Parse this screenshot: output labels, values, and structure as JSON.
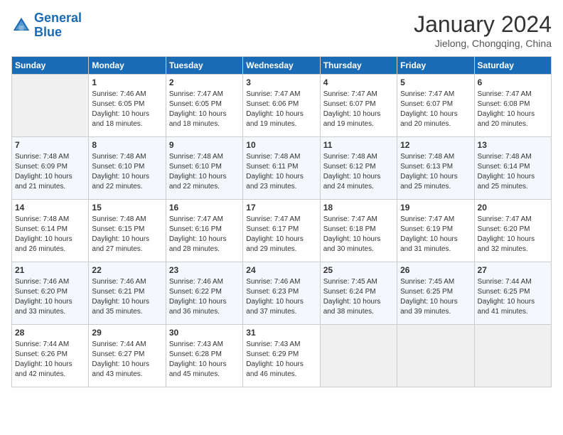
{
  "header": {
    "logo_line1": "General",
    "logo_line2": "Blue",
    "title": "January 2024",
    "location": "Jielong, Chongqing, China"
  },
  "days_of_week": [
    "Sunday",
    "Monday",
    "Tuesday",
    "Wednesday",
    "Thursday",
    "Friday",
    "Saturday"
  ],
  "weeks": [
    [
      {
        "day": "",
        "sunrise": "",
        "sunset": "",
        "daylight": ""
      },
      {
        "day": "1",
        "sunrise": "Sunrise: 7:46 AM",
        "sunset": "Sunset: 6:05 PM",
        "daylight": "Daylight: 10 hours and 18 minutes."
      },
      {
        "day": "2",
        "sunrise": "Sunrise: 7:47 AM",
        "sunset": "Sunset: 6:05 PM",
        "daylight": "Daylight: 10 hours and 18 minutes."
      },
      {
        "day": "3",
        "sunrise": "Sunrise: 7:47 AM",
        "sunset": "Sunset: 6:06 PM",
        "daylight": "Daylight: 10 hours and 19 minutes."
      },
      {
        "day": "4",
        "sunrise": "Sunrise: 7:47 AM",
        "sunset": "Sunset: 6:07 PM",
        "daylight": "Daylight: 10 hours and 19 minutes."
      },
      {
        "day": "5",
        "sunrise": "Sunrise: 7:47 AM",
        "sunset": "Sunset: 6:07 PM",
        "daylight": "Daylight: 10 hours and 20 minutes."
      },
      {
        "day": "6",
        "sunrise": "Sunrise: 7:47 AM",
        "sunset": "Sunset: 6:08 PM",
        "daylight": "Daylight: 10 hours and 20 minutes."
      }
    ],
    [
      {
        "day": "7",
        "sunrise": "Sunrise: 7:48 AM",
        "sunset": "Sunset: 6:09 PM",
        "daylight": "Daylight: 10 hours and 21 minutes."
      },
      {
        "day": "8",
        "sunrise": "Sunrise: 7:48 AM",
        "sunset": "Sunset: 6:10 PM",
        "daylight": "Daylight: 10 hours and 22 minutes."
      },
      {
        "day": "9",
        "sunrise": "Sunrise: 7:48 AM",
        "sunset": "Sunset: 6:10 PM",
        "daylight": "Daylight: 10 hours and 22 minutes."
      },
      {
        "day": "10",
        "sunrise": "Sunrise: 7:48 AM",
        "sunset": "Sunset: 6:11 PM",
        "daylight": "Daylight: 10 hours and 23 minutes."
      },
      {
        "day": "11",
        "sunrise": "Sunrise: 7:48 AM",
        "sunset": "Sunset: 6:12 PM",
        "daylight": "Daylight: 10 hours and 24 minutes."
      },
      {
        "day": "12",
        "sunrise": "Sunrise: 7:48 AM",
        "sunset": "Sunset: 6:13 PM",
        "daylight": "Daylight: 10 hours and 25 minutes."
      },
      {
        "day": "13",
        "sunrise": "Sunrise: 7:48 AM",
        "sunset": "Sunset: 6:14 PM",
        "daylight": "Daylight: 10 hours and 25 minutes."
      }
    ],
    [
      {
        "day": "14",
        "sunrise": "Sunrise: 7:48 AM",
        "sunset": "Sunset: 6:14 PM",
        "daylight": "Daylight: 10 hours and 26 minutes."
      },
      {
        "day": "15",
        "sunrise": "Sunrise: 7:48 AM",
        "sunset": "Sunset: 6:15 PM",
        "daylight": "Daylight: 10 hours and 27 minutes."
      },
      {
        "day": "16",
        "sunrise": "Sunrise: 7:47 AM",
        "sunset": "Sunset: 6:16 PM",
        "daylight": "Daylight: 10 hours and 28 minutes."
      },
      {
        "day": "17",
        "sunrise": "Sunrise: 7:47 AM",
        "sunset": "Sunset: 6:17 PM",
        "daylight": "Daylight: 10 hours and 29 minutes."
      },
      {
        "day": "18",
        "sunrise": "Sunrise: 7:47 AM",
        "sunset": "Sunset: 6:18 PM",
        "daylight": "Daylight: 10 hours and 30 minutes."
      },
      {
        "day": "19",
        "sunrise": "Sunrise: 7:47 AM",
        "sunset": "Sunset: 6:19 PM",
        "daylight": "Daylight: 10 hours and 31 minutes."
      },
      {
        "day": "20",
        "sunrise": "Sunrise: 7:47 AM",
        "sunset": "Sunset: 6:20 PM",
        "daylight": "Daylight: 10 hours and 32 minutes."
      }
    ],
    [
      {
        "day": "21",
        "sunrise": "Sunrise: 7:46 AM",
        "sunset": "Sunset: 6:20 PM",
        "daylight": "Daylight: 10 hours and 33 minutes."
      },
      {
        "day": "22",
        "sunrise": "Sunrise: 7:46 AM",
        "sunset": "Sunset: 6:21 PM",
        "daylight": "Daylight: 10 hours and 35 minutes."
      },
      {
        "day": "23",
        "sunrise": "Sunrise: 7:46 AM",
        "sunset": "Sunset: 6:22 PM",
        "daylight": "Daylight: 10 hours and 36 minutes."
      },
      {
        "day": "24",
        "sunrise": "Sunrise: 7:46 AM",
        "sunset": "Sunset: 6:23 PM",
        "daylight": "Daylight: 10 hours and 37 minutes."
      },
      {
        "day": "25",
        "sunrise": "Sunrise: 7:45 AM",
        "sunset": "Sunset: 6:24 PM",
        "daylight": "Daylight: 10 hours and 38 minutes."
      },
      {
        "day": "26",
        "sunrise": "Sunrise: 7:45 AM",
        "sunset": "Sunset: 6:25 PM",
        "daylight": "Daylight: 10 hours and 39 minutes."
      },
      {
        "day": "27",
        "sunrise": "Sunrise: 7:44 AM",
        "sunset": "Sunset: 6:25 PM",
        "daylight": "Daylight: 10 hours and 41 minutes."
      }
    ],
    [
      {
        "day": "28",
        "sunrise": "Sunrise: 7:44 AM",
        "sunset": "Sunset: 6:26 PM",
        "daylight": "Daylight: 10 hours and 42 minutes."
      },
      {
        "day": "29",
        "sunrise": "Sunrise: 7:44 AM",
        "sunset": "Sunset: 6:27 PM",
        "daylight": "Daylight: 10 hours and 43 minutes."
      },
      {
        "day": "30",
        "sunrise": "Sunrise: 7:43 AM",
        "sunset": "Sunset: 6:28 PM",
        "daylight": "Daylight: 10 hours and 45 minutes."
      },
      {
        "day": "31",
        "sunrise": "Sunrise: 7:43 AM",
        "sunset": "Sunset: 6:29 PM",
        "daylight": "Daylight: 10 hours and 46 minutes."
      },
      {
        "day": "",
        "sunrise": "",
        "sunset": "",
        "daylight": ""
      },
      {
        "day": "",
        "sunrise": "",
        "sunset": "",
        "daylight": ""
      },
      {
        "day": "",
        "sunrise": "",
        "sunset": "",
        "daylight": ""
      }
    ]
  ]
}
